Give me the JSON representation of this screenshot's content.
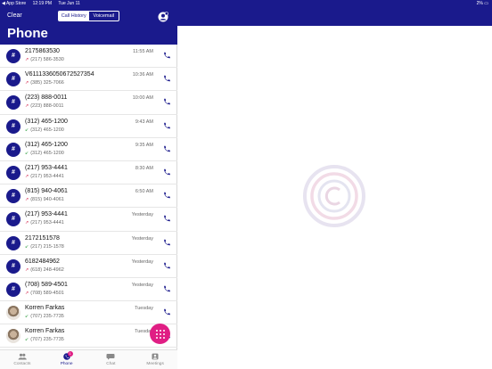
{
  "status_bar": {
    "back_app": "◀ App Store",
    "time": "12:19 PM",
    "date": "Tue Jun 11",
    "right": "2% ▭"
  },
  "header": {
    "clear_label": "Clear",
    "tabs": [
      {
        "label": "Call History",
        "active": true
      },
      {
        "label": "Voicemail",
        "active": false
      }
    ],
    "title": "Phone"
  },
  "calls": [
    {
      "name": "2175863530",
      "number": "(217) 586-3530",
      "type": "missed",
      "time": "11:55 AM",
      "avatar": "#"
    },
    {
      "name": "V611133605067252735​4",
      "number": "(385) 325-7066",
      "type": "missed",
      "time": "10:36 AM",
      "avatar": "#"
    },
    {
      "name": "(223) 888-0011",
      "number": "(223) 888-0011",
      "type": "missed",
      "time": "10:00 AM",
      "avatar": "#"
    },
    {
      "name": "(312) 465-1200",
      "number": "(312) 465-1200",
      "type": "incoming",
      "time": "9:43 AM",
      "avatar": "#"
    },
    {
      "name": "(312) 465-1200",
      "number": "(312) 465-1200",
      "type": "incoming",
      "time": "9:35 AM",
      "avatar": "#"
    },
    {
      "name": "(217) 953-4441",
      "number": "(217) 953-4441",
      "type": "missed",
      "time": "8:30 AM",
      "avatar": "#"
    },
    {
      "name": "(815) 940-4061",
      "number": "(815) 940-4061",
      "type": "missed",
      "time": "6:50 AM",
      "avatar": "#"
    },
    {
      "name": "(217) 953-4441",
      "number": "(217) 953-4441",
      "type": "missed",
      "time": "Yesterday",
      "avatar": "#"
    },
    {
      "name": "2172151578",
      "number": "(217) 215-1578",
      "type": "incoming",
      "time": "Yesterday",
      "avatar": "#"
    },
    {
      "name": "6182484962",
      "number": "(618) 248-4962",
      "type": "missed",
      "time": "Yesterday",
      "avatar": "#"
    },
    {
      "name": "(708) 589-4501",
      "number": "(708) 589-4501",
      "type": "missed",
      "time": "Yesterday",
      "avatar": "#"
    },
    {
      "name": "Korren Farkas",
      "number": "(707) 235-7735",
      "type": "incoming",
      "time": "Tuesday",
      "avatar": "photo"
    },
    {
      "name": "Korren Farkas",
      "number": "(707) 235-7735",
      "type": "incoming",
      "time": "Tuesday",
      "avatar": "photo"
    }
  ],
  "tabbar": [
    {
      "label": "Contacts",
      "icon": "contacts-icon",
      "active": false
    },
    {
      "label": "Phone",
      "icon": "phone-icon",
      "active": true,
      "badge": "1"
    },
    {
      "label": "Chat",
      "icon": "chat-icon",
      "active": false
    },
    {
      "label": "Meetings",
      "icon": "meetings-icon",
      "active": false
    }
  ],
  "colors": {
    "brand": "#1a1a8c",
    "accent": "#e01e84",
    "missed": "#d0143c",
    "incoming": "#2a9a3a"
  }
}
